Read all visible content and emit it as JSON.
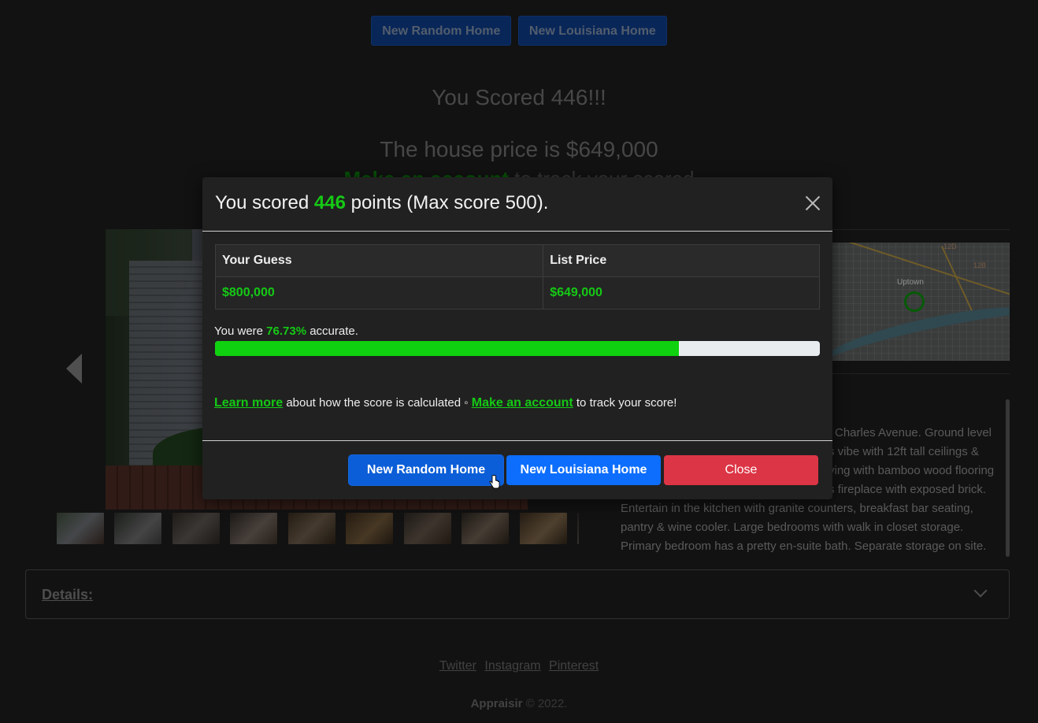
{
  "top_buttons": {
    "random": "New Random Home",
    "louisiana": "New Louisiana Home"
  },
  "background": {
    "score_text": "You Scored 446!!!",
    "price_text": "The house price is $649,000",
    "account_link": "Make an account",
    "account_rest": "to track your scored",
    "map_label": "Uptown",
    "map_route_1": "12D",
    "map_route_2": "12B",
    "description_lines": [
      "Charles Avenue. Ground level",
      "s vibe with 12ft tall ceilings &",
      "ving with bamboo wood flooring",
      "s fireplace with exposed brick.",
      "Entertain in the kitchen with granite counters, breakfast bar seating,",
      "pantry & wine cooler. Large bedrooms with walk in closet storage.",
      "Primary bedroom has a pretty en-suite bath. Separate storage on site."
    ],
    "details_label": "Details:",
    "social": [
      "Twitter",
      "Instagram",
      "Pinterest"
    ],
    "brand": "Appraisir",
    "copyright_suffix": "© 2022."
  },
  "modal": {
    "title_prefix": "You scored",
    "points": "446",
    "title_suffix": "points (Max score 500).",
    "table": {
      "headers": [
        "Your Guess",
        "List Price"
      ],
      "values": [
        "$800,000",
        "$649,000"
      ]
    },
    "accuracy_prefix": "You were",
    "accuracy_pct": "76.73%",
    "accuracy_suffix": "accurate.",
    "accuracy_value": 76.73,
    "learn_more": "Learn more",
    "learn_mid": "about how the score is calculated ◦",
    "make_account": "Make an account",
    "learn_end": "to track your score!",
    "buttons": {
      "random": "New Random Home",
      "louisiana": "New Louisiana Home",
      "close": "Close"
    }
  },
  "colors": {
    "accent_green": "#15c915",
    "primary_blue": "#0d6efd",
    "danger_red": "#dc3545"
  }
}
